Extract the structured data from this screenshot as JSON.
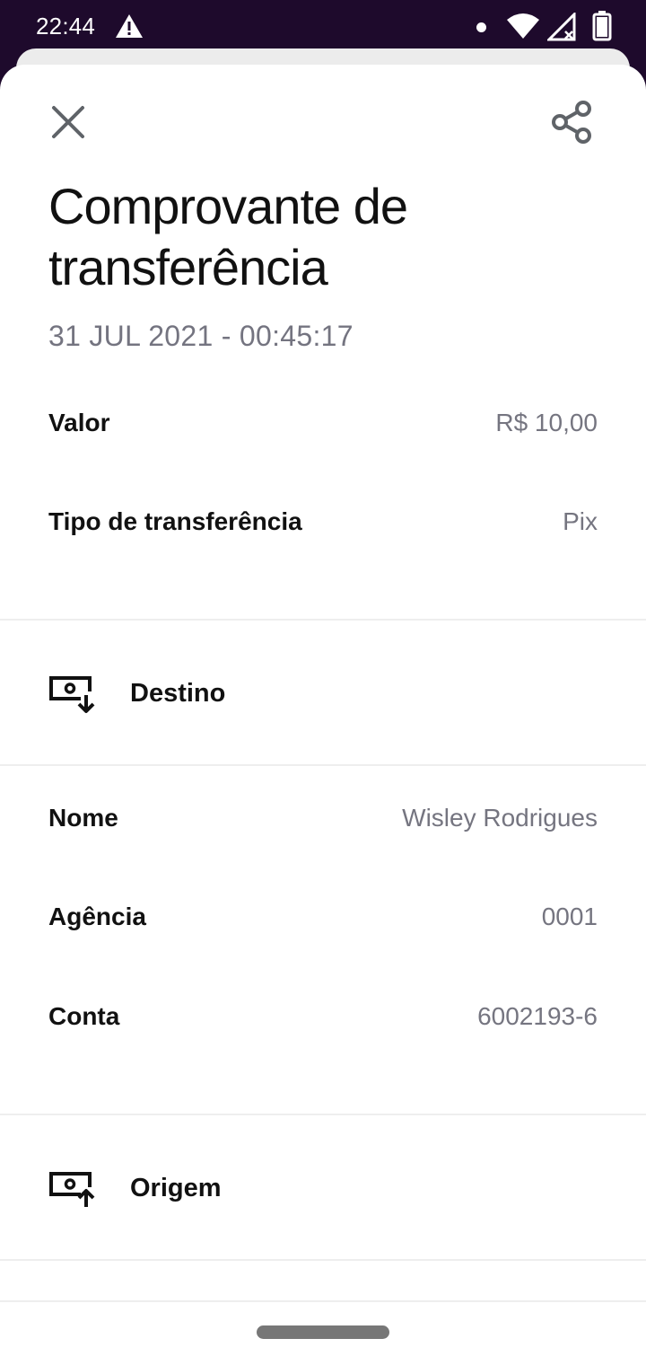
{
  "status_bar": {
    "time": "22:44",
    "icons": [
      "warning-icon",
      "notification-dot",
      "wifi-icon",
      "no-signal-icon",
      "battery-icon"
    ]
  },
  "header": {
    "close_icon": "close-icon",
    "share_icon": "share-icon"
  },
  "receipt": {
    "title_line1": "Comprovante de",
    "title_line2": "transferência",
    "datetime": "31 JUL 2021 - 00:45:17",
    "summary": [
      {
        "label": "Valor",
        "value": "R$ 10,00"
      },
      {
        "label": "Tipo de transferência",
        "value": "Pix"
      }
    ]
  },
  "destination": {
    "icon": "money-receive-icon",
    "title": "Destino",
    "rows": [
      {
        "label": "Nome",
        "value": "Wisley Rodrigues"
      },
      {
        "label": "Agência",
        "value": "0001"
      },
      {
        "label": "Conta",
        "value": "6002193-6"
      }
    ]
  },
  "origin": {
    "icon": "money-send-icon",
    "title": "Origem"
  },
  "colors": {
    "status_bar_bg": "#1e0a2c",
    "text_primary": "#111111",
    "text_secondary": "#757580"
  }
}
